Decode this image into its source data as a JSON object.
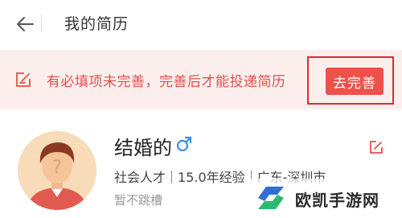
{
  "header": {
    "title": "我的简历",
    "back_icon": "arrow-left-icon"
  },
  "notice": {
    "icon": "edit-square-icon",
    "text": "有必填项未完善，完善后才能投递简历",
    "button_label": "去完善",
    "accent_color": "#f0504a",
    "background_color": "#fdeeee"
  },
  "profile": {
    "name": "结婚的",
    "gender_icon": "male-icon",
    "edit_icon": "edit-icon",
    "meta": [
      "社会人才",
      "15.0年经验",
      "广东-深圳市"
    ],
    "status": "暂不跳槽"
  },
  "watermark": {
    "text": "欧凯手游网",
    "logo": "watermark-logo"
  }
}
